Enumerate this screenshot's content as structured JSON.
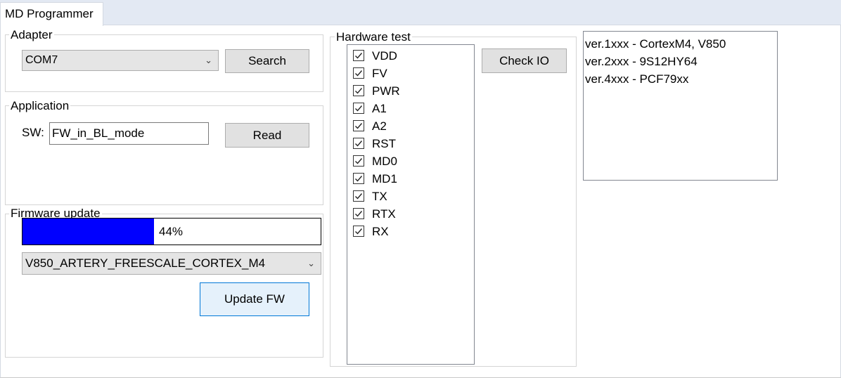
{
  "tab": {
    "label": "MD Programmer"
  },
  "adapter": {
    "title": "Adapter",
    "port": "COM7",
    "search_label": "Search"
  },
  "application": {
    "title": "Application",
    "sw_label": "SW:",
    "sw_value": "FW_in_BL_mode",
    "read_label": "Read"
  },
  "firmware": {
    "title": "Firmware update",
    "progress_percent": 44,
    "progress_text": "44%",
    "progress_color": "#0000ff",
    "target": "V850_ARTERY_FREESCALE_CORTEX_M4",
    "update_label": "Update FW"
  },
  "hardware": {
    "title": "Hardware test",
    "check_label": "Check IO",
    "items": [
      {
        "label": "VDD",
        "checked": true
      },
      {
        "label": "FV",
        "checked": true
      },
      {
        "label": "PWR",
        "checked": true
      },
      {
        "label": "A1",
        "checked": true
      },
      {
        "label": "A2",
        "checked": true
      },
      {
        "label": "RST",
        "checked": true
      },
      {
        "label": "MD0",
        "checked": true
      },
      {
        "label": "MD1",
        "checked": true
      },
      {
        "label": "TX",
        "checked": true
      },
      {
        "label": "RTX",
        "checked": true
      },
      {
        "label": "RX",
        "checked": true
      }
    ]
  },
  "versions": [
    "ver.1xxx - CortexM4, V850",
    "ver.2xxx - 9S12HY64",
    "ver.4xxx - PCF79xx"
  ]
}
